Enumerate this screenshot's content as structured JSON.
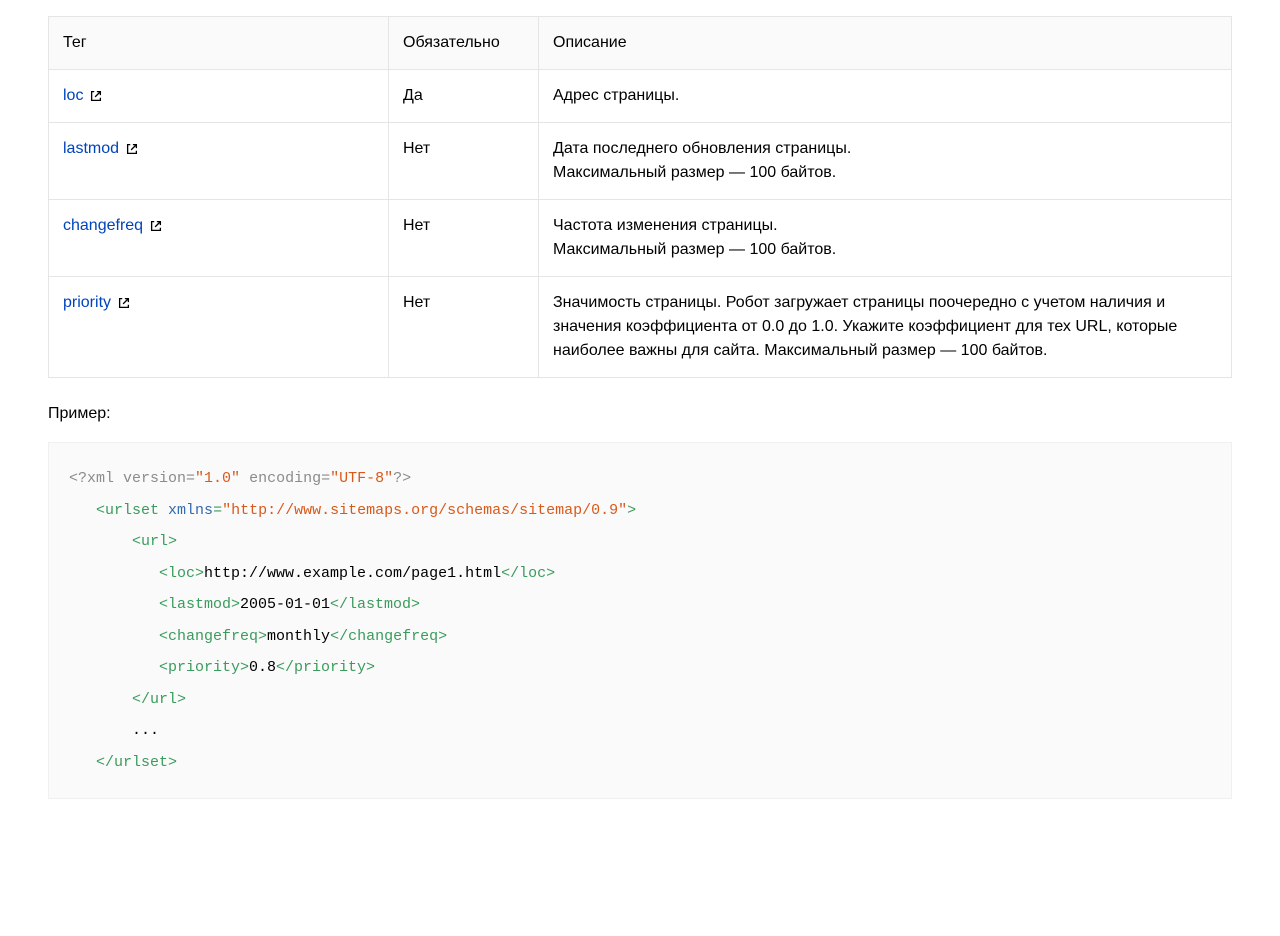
{
  "table": {
    "headers": {
      "tag": "Тег",
      "required": "Обязательно",
      "description": "Описание"
    },
    "rows": [
      {
        "tag": "loc",
        "required": "Да",
        "desc_lines": [
          "Адрес страницы."
        ]
      },
      {
        "tag": "lastmod",
        "required": "Нет",
        "desc_lines": [
          "Дата последнего обновления страницы.",
          "Максимальный размер — 100 байтов."
        ]
      },
      {
        "tag": "changefreq",
        "required": "Нет",
        "desc_lines": [
          "Частота изменения страницы.",
          "Максимальный размер — 100 байтов."
        ]
      },
      {
        "tag": "priority",
        "required": "Нет",
        "desc_lines": [
          "Значимость страницы. Робот загружает страницы поочередно с учетом наличия и значения коэффициента от 0.0 до 1.0. Укажите коэффициент для тех URL, которые наиболее важны для сайта. Максимальный размер — 100 байтов."
        ]
      }
    ]
  },
  "example_label": "Пример:",
  "code": {
    "xml_decl_open": "<?",
    "xml_decl_kw": "xml version=",
    "xml_version": "\"1.0\"",
    "encoding_kw": " encoding=",
    "encoding_val": "\"UTF-8\"",
    "xml_decl_close": "?>",
    "urlset_open_lt": "<",
    "urlset_tag": "urlset",
    "xmlns_attr": " xmlns",
    "xmlns_eq": "=",
    "xmlns_val": "\"http://www.sitemaps.org/schemas/sitemap/0.9\"",
    "gt": ">",
    "url_open": "<url>",
    "loc_open": "<loc>",
    "loc_text": "http://www.example.com/page1.html",
    "loc_close": "</loc>",
    "lastmod_open": "<lastmod>",
    "lastmod_text": "2005-01-01",
    "lastmod_close": "</lastmod>",
    "changefreq_open": "<changefreq>",
    "changefreq_text": "monthly",
    "changefreq_close": "</changefreq>",
    "priority_open": "<priority>",
    "priority_text": "0.8",
    "priority_close": "</priority>",
    "url_close": "</url>",
    "ellipsis": "...",
    "urlset_close": "</urlset>"
  }
}
